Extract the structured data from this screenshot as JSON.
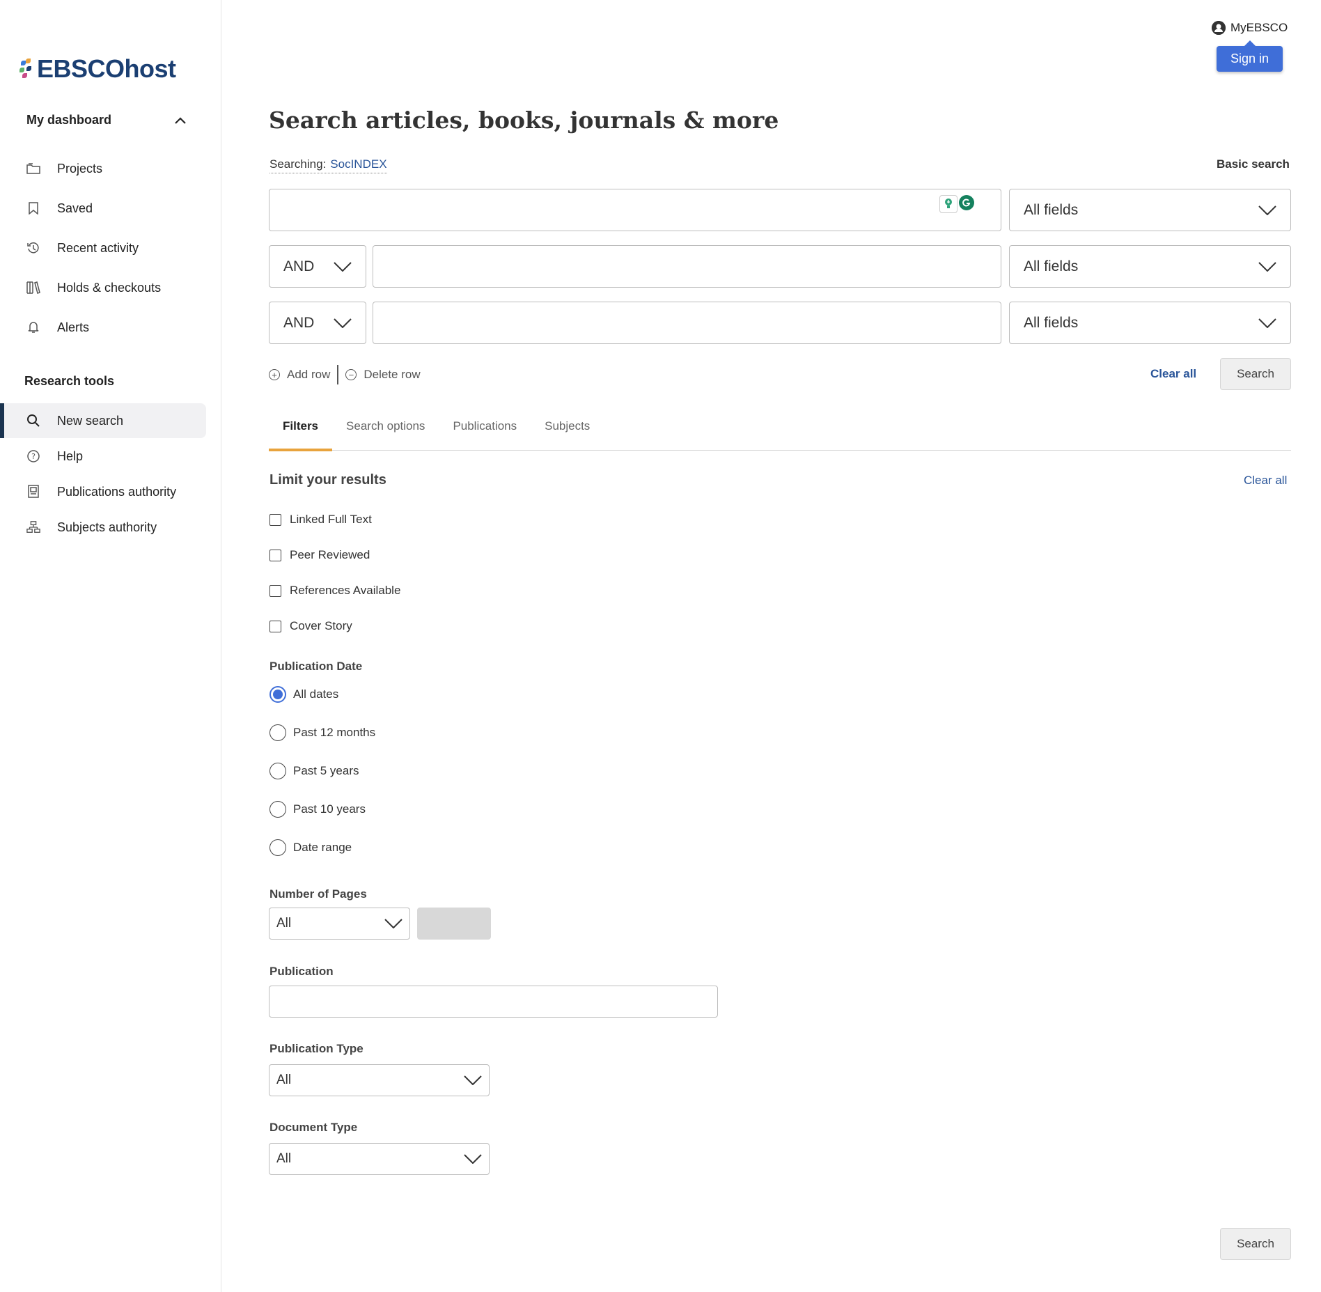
{
  "brand": {
    "logo_text": "EBSCOhost",
    "primary_color": "#1b3f72",
    "accent_color": "#3f6ed8"
  },
  "sidebar": {
    "dashboard_title": "My dashboard",
    "dashboard_items": [
      {
        "label": "Projects",
        "icon": "folder-icon"
      },
      {
        "label": "Saved",
        "icon": "bookmark-icon"
      },
      {
        "label": "Recent activity",
        "icon": "history-icon"
      },
      {
        "label": "Holds & checkouts",
        "icon": "books-icon"
      },
      {
        "label": "Alerts",
        "icon": "bell-icon"
      }
    ],
    "research_title": "Research tools",
    "research_items": [
      {
        "label": "New search",
        "icon": "search-icon",
        "active": true
      },
      {
        "label": "Help",
        "icon": "help-icon"
      },
      {
        "label": "Publications authority",
        "icon": "publication-icon"
      },
      {
        "label": "Subjects authority",
        "icon": "hierarchy-icon"
      }
    ]
  },
  "header": {
    "account_label": "MyEBSCO",
    "sign_in_label": "Sign in"
  },
  "search": {
    "title": "Search articles, books, journals & more",
    "searching_label": "Searching:",
    "database": "SocINDEX",
    "mode_link": "Basic search",
    "rows": [
      {
        "operator": "",
        "value": "",
        "field": "All fields"
      },
      {
        "operator": "AND",
        "value": "",
        "field": "All fields"
      },
      {
        "operator": "AND",
        "value": "",
        "field": "All fields"
      }
    ],
    "add_row": "Add row",
    "delete_row": "Delete row",
    "clear_all": "Clear all",
    "search_button": "Search"
  },
  "tabs": [
    "Filters",
    "Search options",
    "Publications",
    "Subjects"
  ],
  "filters": {
    "title": "Limit your results",
    "clear_all": "Clear all",
    "checkboxes": [
      "Linked Full Text",
      "Peer Reviewed",
      "References Available",
      "Cover Story"
    ],
    "pub_date_label": "Publication Date",
    "pub_date_options": [
      "All dates",
      "Past 12 months",
      "Past 5 years",
      "Past 10 years",
      "Date range"
    ],
    "pub_date_selected": "All dates",
    "pages_label": "Number of Pages",
    "pages_value": "All",
    "publication_label": "Publication",
    "publication_value": "",
    "pub_type_label": "Publication Type",
    "pub_type_value": "All",
    "doc_type_label": "Document Type",
    "doc_type_value": "All"
  },
  "footer": {
    "search_button": "Search"
  }
}
